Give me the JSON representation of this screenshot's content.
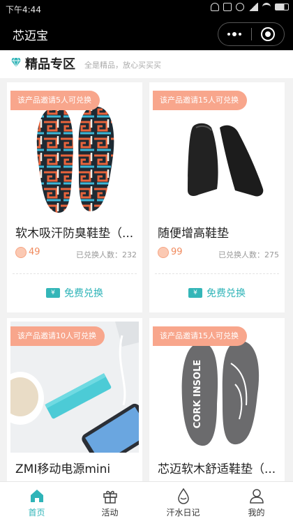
{
  "status_bar": {
    "time": "下午4:44"
  },
  "nav": {
    "title": "芯迈宝"
  },
  "section": {
    "title": "精品专区",
    "subtitle": "全是精品，放心买买买"
  },
  "products": [
    {
      "tag": "该产品邀请5人可兑换",
      "name": "软木吸汗防臭鞋垫（...",
      "price": "49",
      "count": "已兑换人数：232",
      "button": "免费兑换"
    },
    {
      "tag": "该产品邀请15人可兑换",
      "name": "随便增高鞋垫",
      "price": "99",
      "count": "已兑换人数：275",
      "button": "免费兑换"
    },
    {
      "tag": "该产品邀请10人可兑换",
      "name": "ZMI移动电源mini",
      "price": "",
      "count": "",
      "button": ""
    },
    {
      "tag": "该产品邀请15人可兑换",
      "name": "芯迈软木舒适鞋垫（...",
      "price": "",
      "count": "",
      "button": ""
    }
  ],
  "insole_print": "CORK INSOLE",
  "tabs": [
    {
      "label": "首页",
      "icon": "home-icon",
      "active": true
    },
    {
      "label": "活动",
      "icon": "gift-icon",
      "active": false
    },
    {
      "label": "汗水日记",
      "icon": "drop-icon",
      "active": false
    },
    {
      "label": "我的",
      "icon": "user-icon",
      "active": false
    }
  ],
  "colors": {
    "accent": "#2fb4b8",
    "tag": "#f8a68c",
    "price": "#f08a5d",
    "nav": "#000000"
  }
}
